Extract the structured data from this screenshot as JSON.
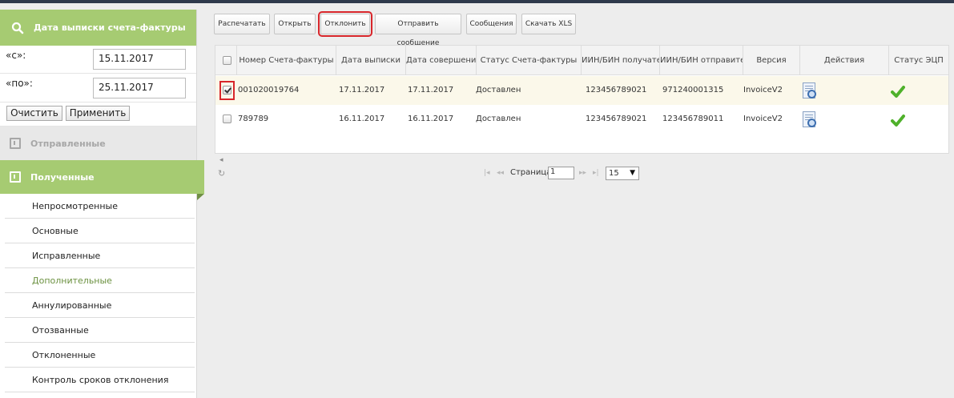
{
  "sidebar": {
    "filter_title": "Дата выписки счета-фактуры",
    "from_label": "«с»:",
    "from_value": "15.11.2017",
    "to_label": "«по»:",
    "to_value": "25.11.2017",
    "clear_label": "Очистить",
    "apply_label": "Применить",
    "sent_label": "Отправленные",
    "received_label": "Полученные",
    "items": [
      {
        "label": "Непросмотренные"
      },
      {
        "label": "Основные"
      },
      {
        "label": "Исправленные"
      },
      {
        "label": "Дополнительные"
      },
      {
        "label": "Аннулированные"
      },
      {
        "label": "Отозванные"
      },
      {
        "label": "Отклоненные"
      },
      {
        "label": "Контроль сроков отклонения"
      }
    ],
    "active_color": "#6b9140",
    "accent_color": "#a6cb72"
  },
  "toolbar": {
    "print": "Распечатать",
    "open": "Открыть",
    "reject": "Отклонить",
    "send_message": "Отправить сообщение",
    "messages": "Сообщения",
    "download_xls": "Скачать XLS"
  },
  "table": {
    "headers": [
      "Номер Счета-фактуры",
      "Дата выписки",
      "Дата совершения",
      "Статус Счета-фактуры",
      "ИИН/БИН получателя",
      "ИИН/БИН отправителя",
      "Версия",
      "Действия",
      "Статус ЭЦП"
    ],
    "rows": [
      {
        "number": "001020019764",
        "issue_date": "17.11.2017",
        "done_date": "17.11.2017",
        "status": "Доставлен",
        "recipient": "123456789021",
        "sender": "971240001315",
        "version": "InvoiceV2",
        "checked": true
      },
      {
        "number": "789789",
        "issue_date": "16.11.2017",
        "done_date": "16.11.2017",
        "status": "Доставлен",
        "recipient": "123456789021",
        "sender": "123456789011",
        "version": "InvoiceV2",
        "checked": false
      }
    ]
  },
  "pager": {
    "page_label": "Страница",
    "page_value": "1",
    "page_size": "15"
  },
  "highlight_color": "#d8262b"
}
